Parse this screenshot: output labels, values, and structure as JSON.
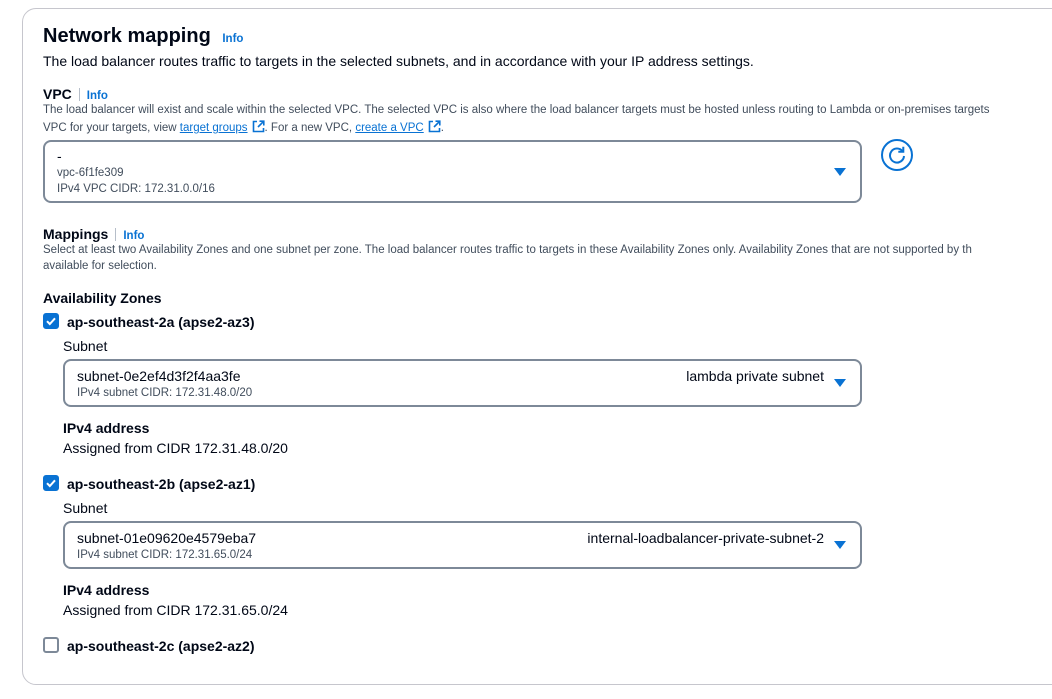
{
  "section": {
    "title": "Network mapping",
    "info": "Info",
    "description": "The load balancer routes traffic to targets in the selected subnets, and in accordance with your IP address settings."
  },
  "vpc": {
    "label": "VPC",
    "info": "Info",
    "desc_line1": "The load balancer will exist and scale within the selected VPC. The selected VPC is also where the load balancer targets must be hosted unless routing to Lambda or on-premises targets",
    "desc_line2_prefix": "VPC for your targets, view ",
    "link_target_groups": "target groups",
    "desc_line2_mid": ". For a new VPC, ",
    "link_create_vpc": "create a VPC",
    "desc_line2_suffix": ".",
    "select": {
      "value": "-",
      "id": "vpc-6f1fe309",
      "cidr": "IPv4 VPC CIDR: 172.31.0.0/16"
    }
  },
  "mappings": {
    "label": "Mappings",
    "info": "Info",
    "desc_line1": "Select at least two Availability Zones and one subnet per zone. The load balancer routes traffic to targets in these Availability Zones only. Availability Zones that are not supported by th",
    "desc_line2": "available for selection.",
    "az_heading": "Availability Zones",
    "zones": [
      {
        "name": "ap-southeast-2a (apse2-az3)",
        "checked": true,
        "subnet_label": "Subnet",
        "subnet_id": "subnet-0e2ef4d3f2f4aa3fe",
        "subnet_name": "lambda private subnet",
        "subnet_cidr": "IPv4 subnet CIDR: 172.31.48.0/20",
        "ipv4_label": "IPv4 address",
        "ipv4_value": "Assigned from CIDR 172.31.48.0/20"
      },
      {
        "name": "ap-southeast-2b (apse2-az1)",
        "checked": true,
        "subnet_label": "Subnet",
        "subnet_id": "subnet-01e09620e4579eba7",
        "subnet_name": "internal-loadbalancer-private-subnet-2",
        "subnet_cidr": "IPv4 subnet CIDR: 172.31.65.0/24",
        "ipv4_label": "IPv4 address",
        "ipv4_value": "Assigned from CIDR 172.31.65.0/24"
      },
      {
        "name": "ap-southeast-2c (apse2-az2)",
        "checked": false
      }
    ]
  },
  "colors": {
    "accent": "#0972d3",
    "border": "#7d8998",
    "text": "#000716",
    "secondary_text": "#414d5c"
  }
}
